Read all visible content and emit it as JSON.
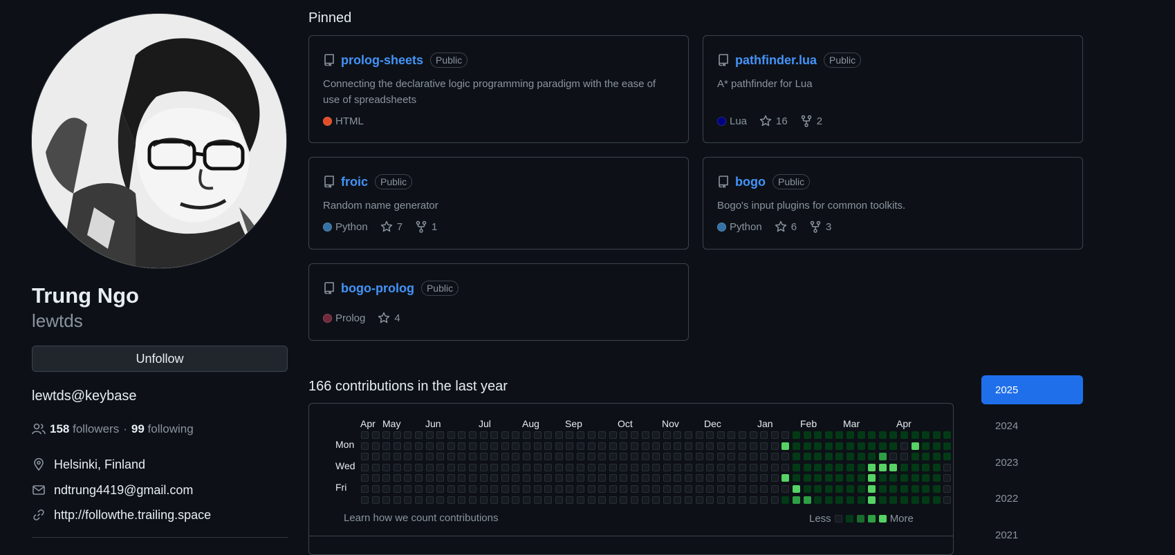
{
  "profile": {
    "full_name": "Trung Ngo",
    "username": "lewtds",
    "unfollow_label": "Unfollow",
    "bio": "lewtds@keybase",
    "followers_count": "158",
    "followers_label": "followers",
    "separator": "·",
    "following_count": "99",
    "following_label": "following",
    "location": "Helsinki, Finland",
    "email": "ndtrung4419@gmail.com",
    "website": "http://followthe.trailing.space"
  },
  "pinned": {
    "title": "Pinned",
    "repos": [
      {
        "name": "prolog-sheets",
        "visibility": "Public",
        "description": "Connecting the declarative logic programming paradigm with the ease of use of spreadsheets",
        "language": "HTML",
        "language_color": "#e34c26",
        "stars": "",
        "forks": ""
      },
      {
        "name": "pathfinder.lua",
        "visibility": "Public",
        "description": "A* pathfinder for Lua",
        "language": "Lua",
        "language_color": "#000080",
        "stars": "16",
        "forks": "2"
      },
      {
        "name": "froic",
        "visibility": "Public",
        "description": "Random name generator",
        "language": "Python",
        "language_color": "#3572A5",
        "stars": "7",
        "forks": "1"
      },
      {
        "name": "bogo",
        "visibility": "Public",
        "description": "Bogo's input plugins for common toolkits.",
        "language": "Python",
        "language_color": "#3572A5",
        "stars": "6",
        "forks": "3"
      },
      {
        "name": "bogo-prolog",
        "visibility": "Public",
        "description": "",
        "language": "Prolog",
        "language_color": "#74283c",
        "stars": "4",
        "forks": ""
      }
    ]
  },
  "contributions": {
    "title": "166 contributions in the last year",
    "months": [
      "Apr",
      "May",
      "Jun",
      "Jul",
      "Aug",
      "Sep",
      "Oct",
      "Nov",
      "Dec",
      "Jan",
      "Feb",
      "Mar",
      "Apr"
    ],
    "days": [
      "Mon",
      "Wed",
      "Fri"
    ],
    "learn_link": "Learn how we count contributions",
    "legend_less": "Less",
    "legend_more": "More",
    "level_colors": [
      "#161b22",
      "#033a16",
      "#196c2e",
      "#2ea043",
      "#56d364"
    ],
    "weeks": [
      "0000000",
      "0000000",
      "0000000",
      "0000000",
      "0000000",
      "0000000",
      "0000000",
      "0000000",
      "0000000",
      "0000000",
      "0000000",
      "0000000",
      "0000000",
      "0000000",
      "0000000",
      "0000000",
      "0000000",
      "0000000",
      "0000000",
      "0000000",
      "0000000",
      "0000000",
      "0000000",
      "0000000",
      "0000000",
      "0000000",
      "0000000",
      "0000000",
      "0000000",
      "0000000",
      "0000000",
      "0000000",
      "0000000",
      "0000000",
      "0000000",
      "0000000",
      "0000000",
      "0000000",
      "0000000",
      "0400401",
      "1111143",
      "1111113",
      "1111111",
      "1111111",
      "1111111",
      "1111111",
      "1111111",
      "1114444",
      "1134111",
      "1104111",
      "1001111",
      "1411111",
      "1111111",
      "1111111",
      "1110000"
    ]
  },
  "years": [
    "2025",
    "2024",
    "2023",
    "2022",
    "2021"
  ],
  "selected_year": "2025"
}
